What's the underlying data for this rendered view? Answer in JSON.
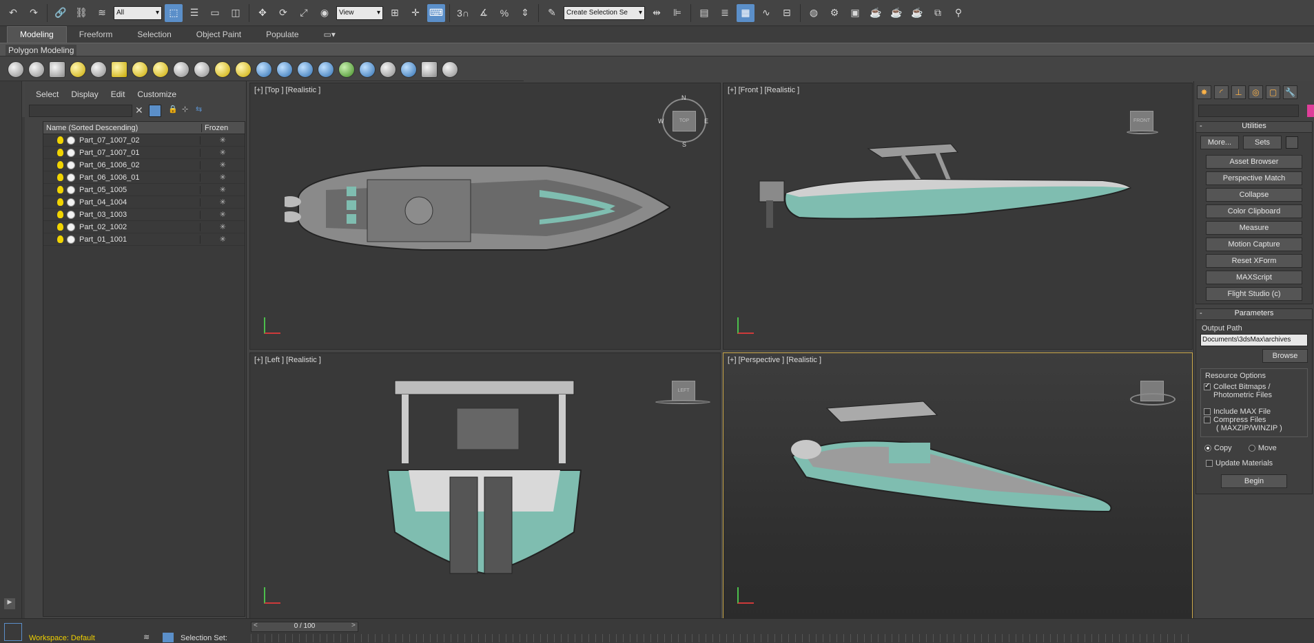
{
  "toolbar": {
    "filter_value": "All",
    "view_value": "View",
    "selection_set_value": "Create Selection Se",
    "snap_label": "3",
    "percent_snap": "%"
  },
  "ribbon": {
    "tabs": [
      "Modeling",
      "Freeform",
      "Selection",
      "Object Paint",
      "Populate"
    ],
    "active_tab": "Modeling",
    "panel_label": "Polygon Modeling"
  },
  "scene_explorer": {
    "menu": [
      "Select",
      "Display",
      "Edit",
      "Customize"
    ],
    "columns": {
      "name": "Name (Sorted Descending)",
      "frozen": "Frozen"
    },
    "rows": [
      "Part_07_1007_02",
      "Part_07_1007_01",
      "Part_06_1006_02",
      "Part_06_1006_01",
      "Part_05_1005",
      "Part_04_1004",
      "Part_03_1003",
      "Part_02_1002",
      "Part_01_1001"
    ]
  },
  "viewports": {
    "top": "[+] [Top ] [Realistic ]",
    "front": "[+] [Front ] [Realistic ]",
    "left": "[+] [Left ] [Realistic ]",
    "persp": "[+] [Perspective ] [Realistic ]",
    "compass": {
      "n": "N",
      "s": "S",
      "e": "E",
      "w": "W"
    },
    "cube_top": "TOP",
    "cube_front": "FRONT",
    "cube_left": "LEFT"
  },
  "command_panel": {
    "utilities_title": "Utilities",
    "more": "More...",
    "sets": "Sets",
    "utilities": [
      "Asset Browser",
      "Perspective Match",
      "Collapse",
      "Color Clipboard",
      "Measure",
      "Motion Capture",
      "Reset XForm",
      "MAXScript",
      "Flight Studio (c)"
    ],
    "parameters_title": "Parameters",
    "output_path_label": "Output Path",
    "output_path": "Documents\\3dsMax\\archives",
    "browse": "Browse",
    "resource_options": "Resource Options",
    "collect_bitmaps": "Collect Bitmaps /",
    "photometric": "Photometric Files",
    "include_max": "Include MAX File",
    "compress_files": "Compress Files",
    "maxzip": "( MAXZIP/WINZIP )",
    "copy": "Copy",
    "move": "Move",
    "update_materials": "Update Materials",
    "begin": "Begin"
  },
  "status": {
    "timeline": "0 / 100",
    "workspace": "Workspace: Default",
    "selection_set": "Selection Set:"
  },
  "colors": {
    "hull": "#7fbdb0",
    "accent": "#5b8fc9",
    "active_viewport": "#c7a445"
  }
}
